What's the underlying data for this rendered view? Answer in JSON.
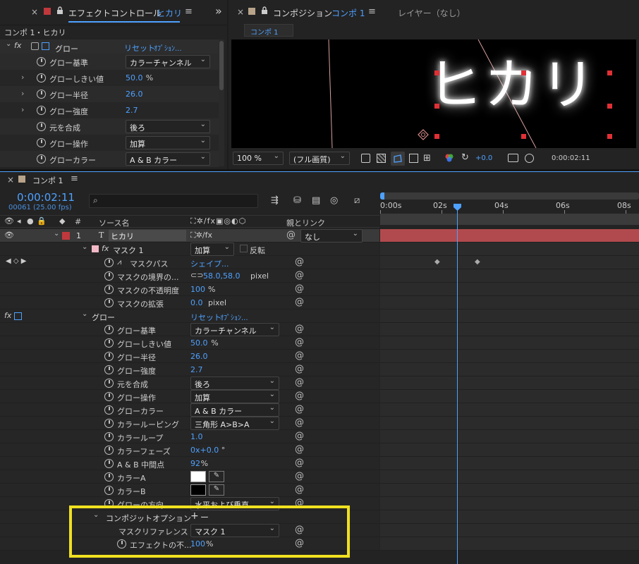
{
  "effect_panel": {
    "close": "×",
    "title": "エフェクトコントロール",
    "layer": "ヒカリ",
    "menu": "≡",
    "collapse": "»",
    "breadcrumb": "コンポ 1・ヒカリ",
    "fx_label": "fx",
    "effect_name": "グロー",
    "reset": "リセット",
    "options": "ｵﾌﾟｼｮﾝ...",
    "props": [
      {
        "name": "グロー基準",
        "type": "dropdown",
        "value": "カラーチャンネル",
        "twirl": false
      },
      {
        "name": "グローしきい値",
        "type": "number",
        "value": "50.0",
        "unit": "%",
        "twirl": true
      },
      {
        "name": "グロー半径",
        "type": "number",
        "value": "26.0",
        "unit": "",
        "twirl": true
      },
      {
        "name": "グロー強度",
        "type": "number",
        "value": "2.7",
        "unit": "",
        "twirl": true
      },
      {
        "name": "元を合成",
        "type": "dropdown",
        "value": "後ろ",
        "twirl": false
      },
      {
        "name": "グロー操作",
        "type": "dropdown",
        "value": "加算",
        "twirl": false
      },
      {
        "name": "グローカラー",
        "type": "dropdown",
        "value": "A & B カラー",
        "twirl": false
      }
    ]
  },
  "comp_panel": {
    "close": "×",
    "title": "コンポジション",
    "comp": "コンポ 1",
    "menu": "≡",
    "layer_tab": "レイヤー（なし）",
    "comp_tab": "コンポ 1",
    "viewer_text": "ヒカリ",
    "zoom": "100 %",
    "resolution": "(フル画質)",
    "exposure": "+0.0",
    "timecode": "0:00:02:11"
  },
  "timeline": {
    "close": "×",
    "comp_name": "コンポ 1",
    "menu": "≡",
    "timecode": "0:00:02:11",
    "frames": "00061 (25.00 fps)",
    "search_placeholder": "",
    "col_num": "#",
    "col_source": "ソース名",
    "col_parent": "親とリンク",
    "ruler": [
      "0:00s",
      "02s",
      "04s",
      "06s",
      "08s"
    ],
    "layer": {
      "num": "1",
      "type": "T",
      "name": "ヒカリ",
      "parent": "なし"
    },
    "mask": {
      "name": "マスク 1",
      "mode": "加算",
      "invert": "反転",
      "path_name": "マスクパス",
      "path_value": "シェイプ...",
      "feather_name": "マスクの境界の...",
      "feather_value": "58.0,58.0",
      "feather_unit": "pixel",
      "opacity_name": "マスクの不透明度",
      "opacity_value": "100",
      "opacity_unit": "%",
      "expansion_name": "マスクの拡張",
      "expansion_value": "0.0",
      "expansion_unit": "pixel"
    },
    "glow": {
      "name": "グロー",
      "reset": "リセット",
      "options": "ｵﾌﾟｼｮﾝ...",
      "props": [
        {
          "name": "グロー基準",
          "type": "dropdown",
          "value": "カラーチャンネル"
        },
        {
          "name": "グローしきい値",
          "type": "number",
          "value": "50.0",
          "unit": "%"
        },
        {
          "name": "グロー半径",
          "type": "number",
          "value": "26.0",
          "unit": ""
        },
        {
          "name": "グロー強度",
          "type": "number",
          "value": "2.7",
          "unit": ""
        },
        {
          "name": "元を合成",
          "type": "dropdown",
          "value": "後ろ"
        },
        {
          "name": "グロー操作",
          "type": "dropdown",
          "value": "加算"
        },
        {
          "name": "グローカラー",
          "type": "dropdown",
          "value": "A & B カラー"
        },
        {
          "name": "カラールーピング",
          "type": "dropdown",
          "value": "三角形 A>B>A"
        },
        {
          "name": "カラーループ",
          "type": "number",
          "value": "1.0",
          "unit": ""
        },
        {
          "name": "カラーフェーズ",
          "type": "number",
          "value": "0x+0.0",
          "unit": "°"
        },
        {
          "name": "A & B 中間点",
          "type": "number",
          "value": "92",
          "unit": "%"
        },
        {
          "name": "カラーA",
          "type": "color",
          "value": "#ffffff"
        },
        {
          "name": "カラーB",
          "type": "color",
          "value": "#000000"
        },
        {
          "name": "グローの方向",
          "type": "dropdown",
          "value": "水平および垂直"
        }
      ]
    },
    "composite": {
      "name": "コンポジットオプション",
      "add": "+",
      "remove": "ー",
      "mask_ref_name": "マスクリファレンス 1",
      "mask_ref_value": "マスク 1",
      "effect_opacity_name": "エフェクトの不...",
      "effect_opacity_value": "100",
      "effect_opacity_unit": "%"
    }
  },
  "colors": {
    "accent": "#4ea1ff",
    "highlight": "#f0e020",
    "layer_bar": "#b14a4e",
    "label_red": "#c0383c",
    "mask_pink": "#f2b8c6"
  }
}
